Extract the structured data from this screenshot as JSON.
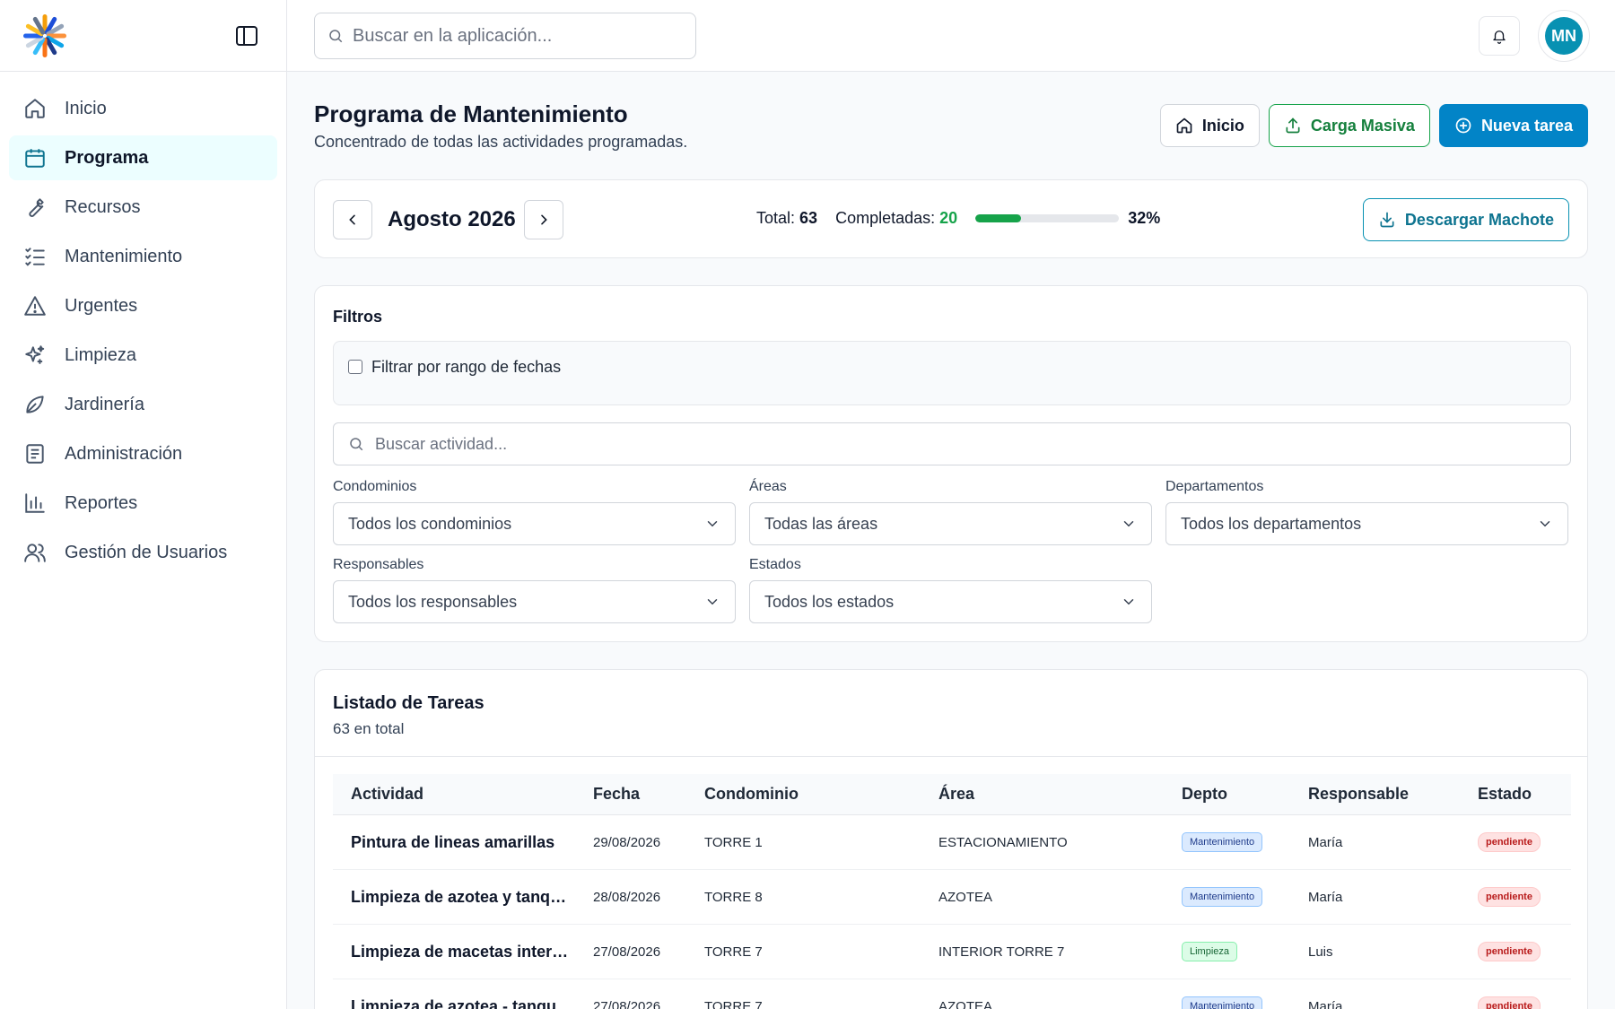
{
  "app": {
    "search_placeholder": "Buscar en la aplicación...",
    "avatar_initials": "MN",
    "accent_color": "#0284c7"
  },
  "sidebar": {
    "items": [
      {
        "label": "Inicio",
        "icon": "home-icon",
        "active": false
      },
      {
        "label": "Programa",
        "icon": "calendar-icon",
        "active": true
      },
      {
        "label": "Recursos",
        "icon": "wrench-icon",
        "active": false
      },
      {
        "label": "Mantenimiento",
        "icon": "list-check-icon",
        "active": false
      },
      {
        "label": "Urgentes",
        "icon": "alert-triangle-icon",
        "active": false
      },
      {
        "label": "Limpieza",
        "icon": "sparkles-icon",
        "active": false
      },
      {
        "label": "Jardinería",
        "icon": "leaf-icon",
        "active": false
      },
      {
        "label": "Administración",
        "icon": "document-icon",
        "active": false
      },
      {
        "label": "Reportes",
        "icon": "bar-chart-icon",
        "active": false
      },
      {
        "label": "Gestión de Usuarios",
        "icon": "users-icon",
        "active": false
      }
    ]
  },
  "page": {
    "title": "Programa de Mantenimiento",
    "subtitle": "Concentrado de todas las actividades programadas.",
    "actions": {
      "home": "Inicio",
      "bulk_upload": "Carga Masiva",
      "new_task": "Nueva tarea"
    }
  },
  "month": {
    "label": "Agosto 2026",
    "total_label": "Total:",
    "total": "63",
    "completed_label": "Completadas:",
    "completed": "20",
    "progress_fraction": 0.32,
    "percent_text": "32%",
    "download_label": "Descargar Machote"
  },
  "filters": {
    "title": "Filtros",
    "date_range_label": "Filtrar por rango de fechas",
    "activity_placeholder": "Buscar actividad...",
    "condominios": {
      "label": "Condominios",
      "value": "Todos los condominios"
    },
    "areas": {
      "label": "Áreas",
      "value": "Todas las áreas"
    },
    "departamentos": {
      "label": "Departamentos",
      "value": "Todos los departamentos"
    },
    "responsables": {
      "label": "Responsables",
      "value": "Todos los responsables"
    },
    "estados": {
      "label": "Estados",
      "value": "Todos los estados"
    }
  },
  "tasks": {
    "title": "Listado de Tareas",
    "count": "63 en total",
    "columns": [
      "Actividad",
      "Fecha",
      "Condominio",
      "Área",
      "Depto",
      "Responsable",
      "Estado"
    ],
    "rows": [
      {
        "actividad": "Pintura de lineas amarillas",
        "fecha": "29/08/2026",
        "condominio": "TORRE 1",
        "area": "ESTACIONAMIENTO",
        "depto": "Mantenimiento",
        "depto_type": "mant",
        "responsable": "María",
        "estado": "pendiente"
      },
      {
        "actividad": "Limpieza de azotea y tanque...",
        "fecha": "28/08/2026",
        "condominio": "TORRE 8",
        "area": "AZOTEA",
        "depto": "Mantenimiento",
        "depto_type": "mant",
        "responsable": "María",
        "estado": "pendiente"
      },
      {
        "actividad": "Limpieza de macetas internas",
        "fecha": "27/08/2026",
        "condominio": "TORRE 7",
        "area": "INTERIOR TORRE 7",
        "depto": "Limpieza",
        "depto_type": "limp",
        "responsable": "Luis",
        "estado": "pendiente"
      },
      {
        "actividad": "Limpieza de azotea - tanque...",
        "fecha": "27/08/2026",
        "condominio": "TORRE 7",
        "area": "AZOTEA",
        "depto": "Mantenimiento",
        "depto_type": "mant",
        "responsable": "María",
        "estado": "pendiente"
      }
    ]
  }
}
